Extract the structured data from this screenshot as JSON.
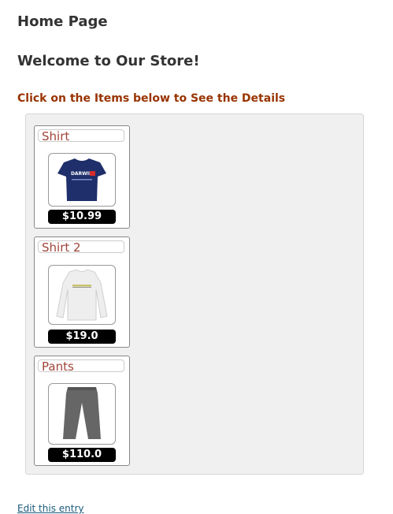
{
  "page": {
    "title": "Home Page",
    "welcome": "Welcome to Our Store!",
    "instruction": "Click on the Items below to See the Details"
  },
  "products": [
    {
      "name": "Shirt",
      "price": "$10.99",
      "image": "navy-tshirt-icon",
      "print_text": "DARWIN",
      "color": "#1f2f6b"
    },
    {
      "name": "Shirt 2",
      "price": "$19.0",
      "image": "white-longsleeve-shirt-icon",
      "color": "#eeeeee"
    },
    {
      "name": "Pants",
      "price": "$110.0",
      "image": "gray-pants-icon",
      "color": "#666666"
    }
  ],
  "footer": {
    "edit_link": "Edit this entry"
  }
}
